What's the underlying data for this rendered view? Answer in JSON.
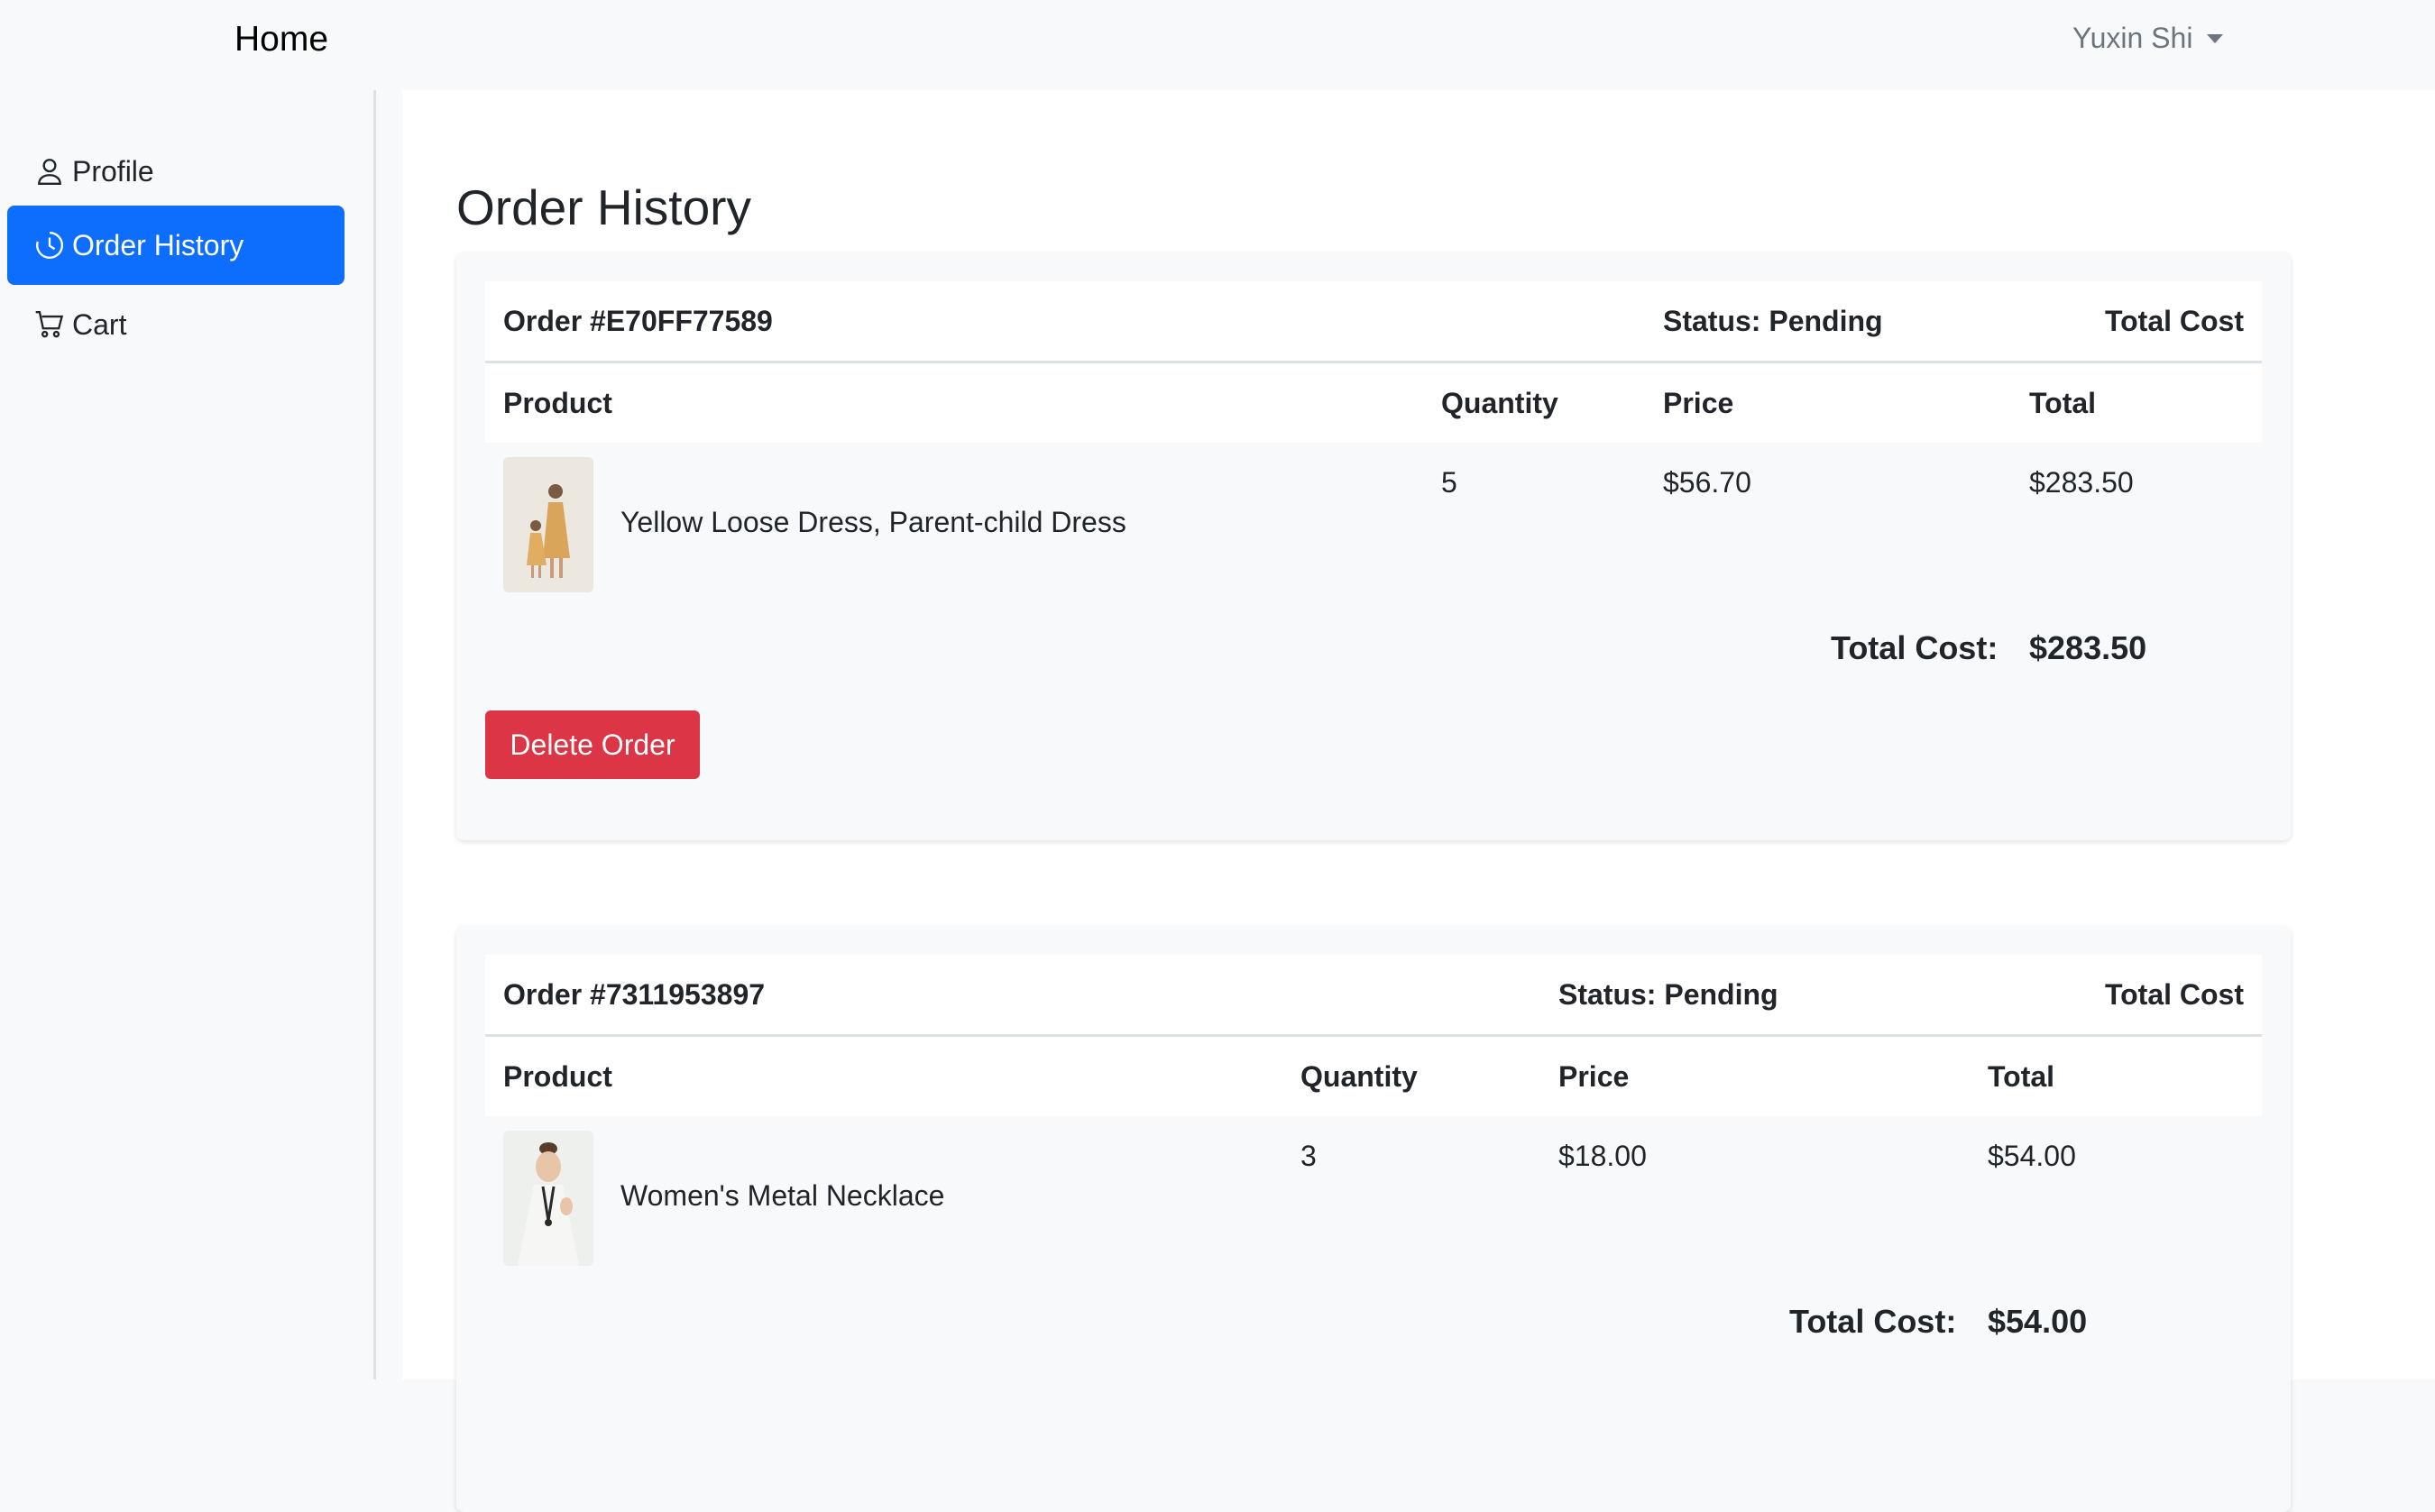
{
  "navbar": {
    "brand": "Home",
    "user": "Yuxin Shi"
  },
  "sidebar": {
    "items": [
      {
        "label": "Profile",
        "icon": "person-icon",
        "active": false
      },
      {
        "label": "Order History",
        "icon": "clock-icon",
        "active": true
      },
      {
        "label": "Cart",
        "icon": "cart-icon",
        "active": false
      }
    ]
  },
  "main": {
    "title": "Order History",
    "orders": [
      {
        "order_label": "Order #E70FF77589",
        "status": "Status: Pending",
        "total_cost_header": "Total Cost",
        "columns": [
          "Product",
          "Quantity",
          "Price",
          "Total"
        ],
        "items": [
          {
            "name": "Yellow Loose Dress, Parent-child Dress",
            "quantity": "5",
            "price": "$56.70",
            "total": "$283.50"
          }
        ],
        "total_label": "Total Cost:",
        "total_value": "$283.50",
        "delete_label": "Delete Order"
      },
      {
        "order_label": "Order #7311953897",
        "status": "Status: Pending",
        "total_cost_header": "Total Cost",
        "columns": [
          "Product",
          "Quantity",
          "Price",
          "Total"
        ],
        "items": [
          {
            "name": "Women's Metal Necklace",
            "quantity": "3",
            "price": "$18.00",
            "total": "$54.00"
          }
        ],
        "total_label": "Total Cost:",
        "total_value": "$54.00"
      }
    ]
  },
  "colors": {
    "primary": "#0d6efd",
    "danger": "#dc3545",
    "bg": "#f8f9fa"
  }
}
